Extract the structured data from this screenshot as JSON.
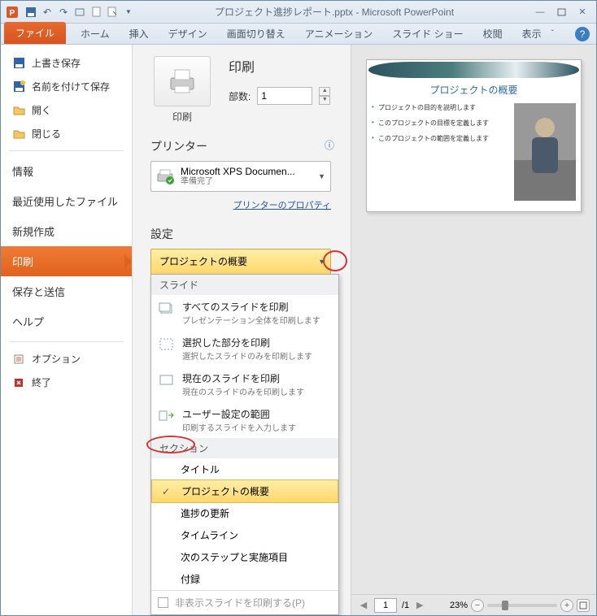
{
  "titlebar": {
    "title": "プロジェクト進捗レポート.pptx - Microsoft PowerPoint"
  },
  "ribbon": {
    "tabs": [
      "ファイル",
      "ホーム",
      "挿入",
      "デザイン",
      "画面切り替え",
      "アニメーション",
      "スライド ショー",
      "校閲",
      "表示"
    ]
  },
  "sidebar": {
    "items": [
      {
        "label": "上書き保存",
        "icon": "save"
      },
      {
        "label": "名前を付けて保存",
        "icon": "saveas"
      },
      {
        "label": "開く",
        "icon": "open"
      },
      {
        "label": "閉じる",
        "icon": "close"
      },
      {
        "label": "情報"
      },
      {
        "label": "最近使用したファイル"
      },
      {
        "label": "新規作成"
      },
      {
        "label": "印刷",
        "selected": true
      },
      {
        "label": "保存と送信"
      },
      {
        "label": "ヘルプ"
      },
      {
        "label": "オプション",
        "icon": "options"
      },
      {
        "label": "終了",
        "icon": "exit"
      }
    ]
  },
  "print": {
    "heading": "印刷",
    "button": "印刷",
    "copies_label": "部数:",
    "copies_value": "1",
    "printer_heading": "プリンター",
    "printer_name": "Microsoft XPS Documen...",
    "printer_status": "準備完了",
    "printer_props": "プリンターのプロパティ",
    "settings_heading": "設定",
    "range_selected": "プロジェクトの概要",
    "dropdown": {
      "group_slides": "スライド",
      "opts": [
        {
          "t": "すべてのスライドを印刷",
          "d": "プレゼンテーション全体を印刷します"
        },
        {
          "t": "選択した部分を印刷",
          "d": "選択したスライドのみを印刷します"
        },
        {
          "t": "現在のスライドを印刷",
          "d": "現在のスライドのみを印刷します"
        },
        {
          "t": "ユーザー設定の範囲",
          "d": "印刷するスライドを入力します"
        }
      ],
      "group_sections": "セクション",
      "sections": [
        "タイトル",
        "プロジェクトの概要",
        "進捗の更新",
        "タイムライン",
        "次のステップと実施項目",
        "付録"
      ],
      "section_selected": 1,
      "hidden": "非表示スライドを印刷する(P)"
    }
  },
  "preview": {
    "slide_title": "プロジェクトの概要",
    "bullets": [
      "プロジェクトの目的を説明します",
      "このプロジェクトの目標を定義します",
      "このプロジェクトの範囲を定義します"
    ],
    "page": "1",
    "pages": "/1",
    "zoom": "23%"
  }
}
